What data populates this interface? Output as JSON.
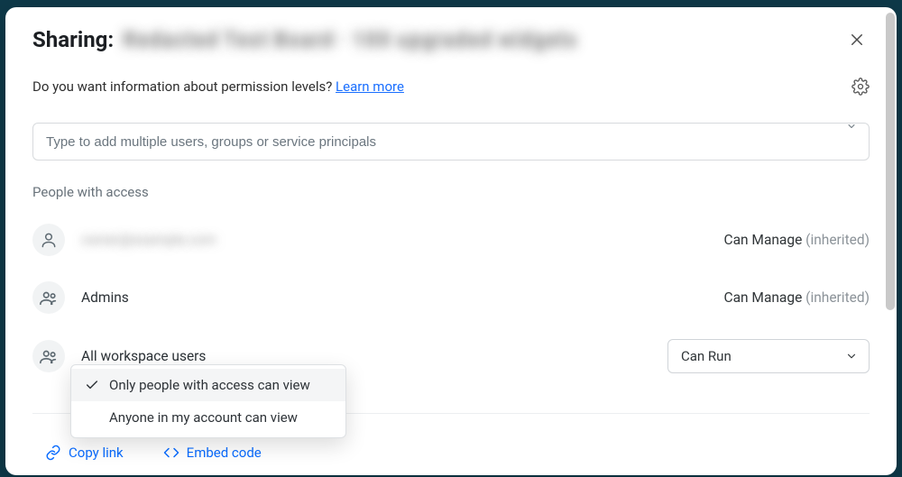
{
  "header": {
    "prefix": "Sharing:",
    "title_obscured": "Redacted Test Board · 100 upgraded widgets"
  },
  "info": {
    "text": "Do you want information about permission levels? ",
    "learn_more": "Learn more"
  },
  "search": {
    "placeholder": "Type to add multiple users, groups or service principals"
  },
  "section_label": "People with access",
  "people": [
    {
      "name": "owner@example.com",
      "name_obscured": true,
      "icon": "person",
      "permission": "Can Manage",
      "inherited": "(inherited)"
    },
    {
      "name": "Admins",
      "name_obscured": false,
      "icon": "group",
      "permission": "Can Manage",
      "inherited": "(inherited)"
    },
    {
      "name": "All workspace users",
      "name_obscured": false,
      "icon": "group",
      "permission_select": "Can Run"
    }
  ],
  "visibility_menu": {
    "options": [
      "Only people with access can view",
      "Anyone in my account can view"
    ],
    "selected_index": 0
  },
  "footer": {
    "copy_link": "Copy link",
    "embed_code": "Embed code"
  }
}
